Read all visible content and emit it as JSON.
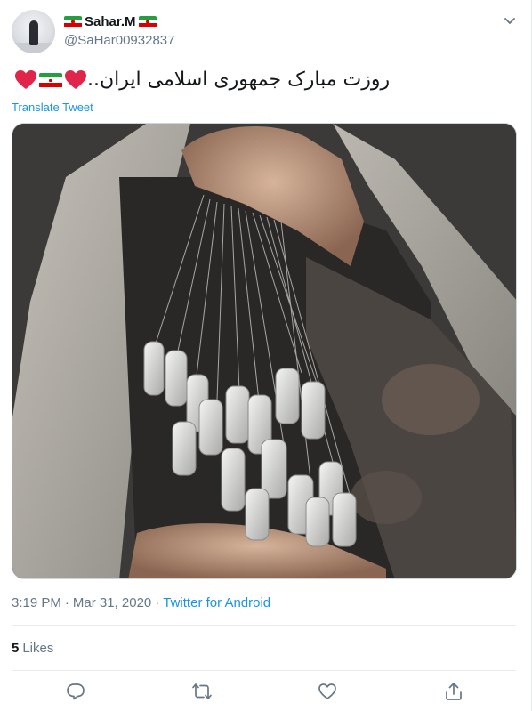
{
  "tweet": {
    "display_name": "Sahar.M",
    "handle": "@SaHar00932837",
    "text": "روزت مبارک جمهوری اسلامی ایران..",
    "translate_label": "Translate Tweet",
    "time": "3:19 PM",
    "separator": "·",
    "date": "Mar 31, 2020",
    "source": "Twitter for Android",
    "likes_count": "5",
    "likes_label": "Likes"
  },
  "icons": {
    "caret": "chevron-down-icon",
    "reply": "reply-icon",
    "retweet": "retweet-icon",
    "like": "heart-icon",
    "share": "share-icon"
  },
  "colors": {
    "link": "#1b95e0",
    "secondary_text": "#657786",
    "primary_text": "#14171a",
    "divider": "#e6ecf0",
    "heart_emoji": "#e0244a",
    "flag_green": "#239f40",
    "flag_red": "#da0000"
  }
}
